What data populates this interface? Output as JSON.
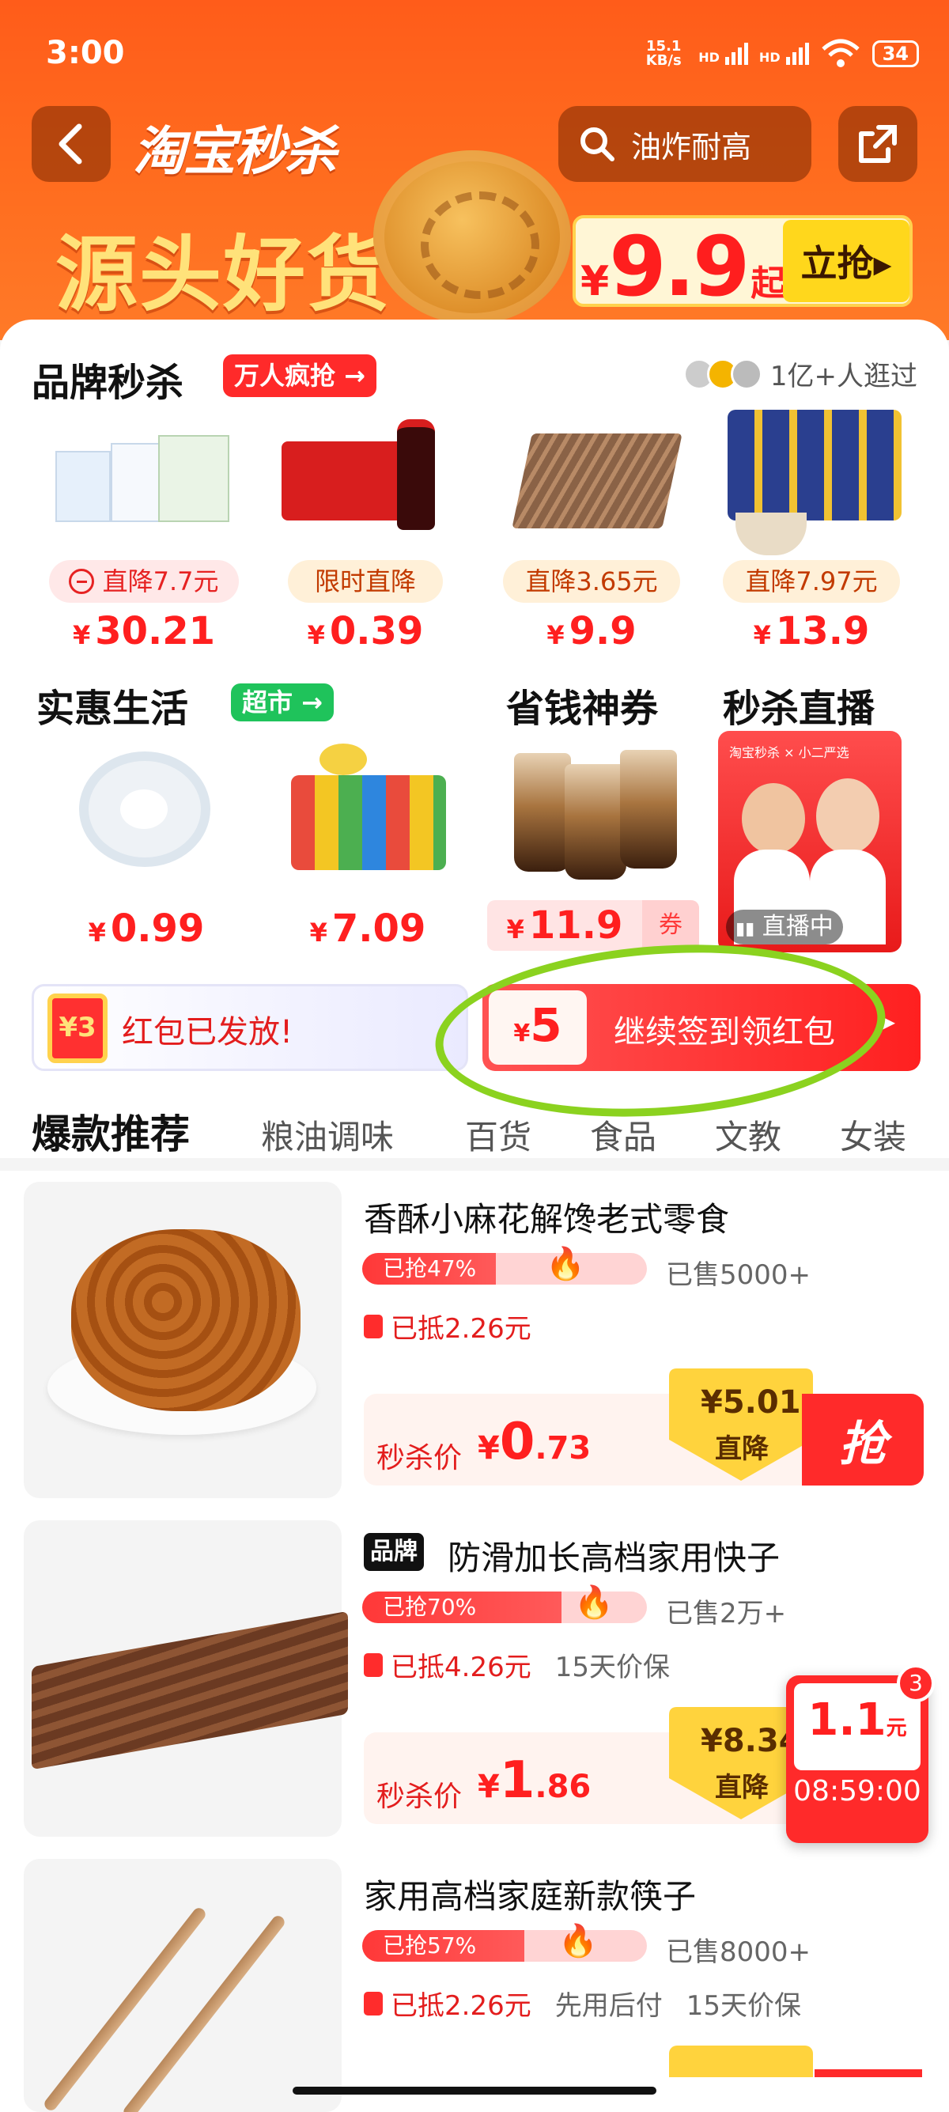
{
  "status_bar": {
    "time": "3:00",
    "net_speed": "15.1 KB/s",
    "sig1": "HD",
    "sig2": "HD",
    "battery": "34"
  },
  "header": {
    "logo": "淘宝秒杀",
    "search_text": "油炸耐高",
    "banner_text": "源头好货",
    "price_symbol": "¥",
    "price": "9.9",
    "price_suffix": "起",
    "grab_label": "立抢▸"
  },
  "brand_section": {
    "title": "品牌秒杀",
    "tag": "万人疯抢 →",
    "visitors": "1亿+人逛过",
    "products": [
      {
        "discount": "直降7.7元",
        "price": "30.21",
        "style": "pink"
      },
      {
        "discount": "限时直降",
        "price": "0.39",
        "style": "orange"
      },
      {
        "discount": "直降3.65元",
        "price": "9.9",
        "style": "orange"
      },
      {
        "discount": "直降7.97元",
        "price": "13.9",
        "style": "orange"
      }
    ]
  },
  "life_section": {
    "title": "实惠生活",
    "tag": "超市 →",
    "price1": "0.99",
    "price2": "7.09"
  },
  "coupon_section": {
    "title": "省钱神券",
    "price": "11.9",
    "tag": "券"
  },
  "live_section": {
    "title": "秒杀直播",
    "header_text": "淘宝秒杀 × 小二严选",
    "live_label": "直播中"
  },
  "currency": "¥",
  "redpacket": {
    "icon_text": "¥3",
    "left_text": "红包已发放!",
    "coupon_symbol": "¥",
    "coupon_amount": "5",
    "right_text": "继续签到领红包",
    "arrow": "▸"
  },
  "tabs": {
    "main": "爆款推荐",
    "items": [
      "粮油调味",
      "百货",
      "食品",
      "文教",
      "女装"
    ]
  },
  "items": [
    {
      "title": "香酥小麻花解馋老式零食",
      "sold_pct_label": "已抢47%",
      "sold_pct": 47,
      "sold": "已售5000+",
      "deduct": "已抵2.26元",
      "extra": "",
      "deal_label": "秒杀价",
      "deal_int": "0",
      "deal_dec": ".73",
      "drop_amt": "¥5.01",
      "drop_label": "直降",
      "buy": "抢"
    },
    {
      "brand": "品牌",
      "title": "防滑加长高档家用快子",
      "sold_pct_label": "已抢70%",
      "sold_pct": 70,
      "sold": "已售2万+",
      "deduct": "已抵4.26元",
      "extra": "15天价保",
      "deal_label": "秒杀价",
      "deal_int": "1",
      "deal_dec": ".86",
      "drop_amt": "¥8.34",
      "drop_label": "直降"
    },
    {
      "title": "家用高档家庭新款筷子",
      "sold_pct_label": "已抢57%",
      "sold_pct": 57,
      "sold": "已售8000+",
      "deduct": "已抵2.26元",
      "extra": "先用后付",
      "extra2": "15天价保"
    }
  ],
  "float_timer": {
    "amount": "1.1",
    "unit": "元",
    "time": "08:59:00",
    "badge": "3"
  }
}
